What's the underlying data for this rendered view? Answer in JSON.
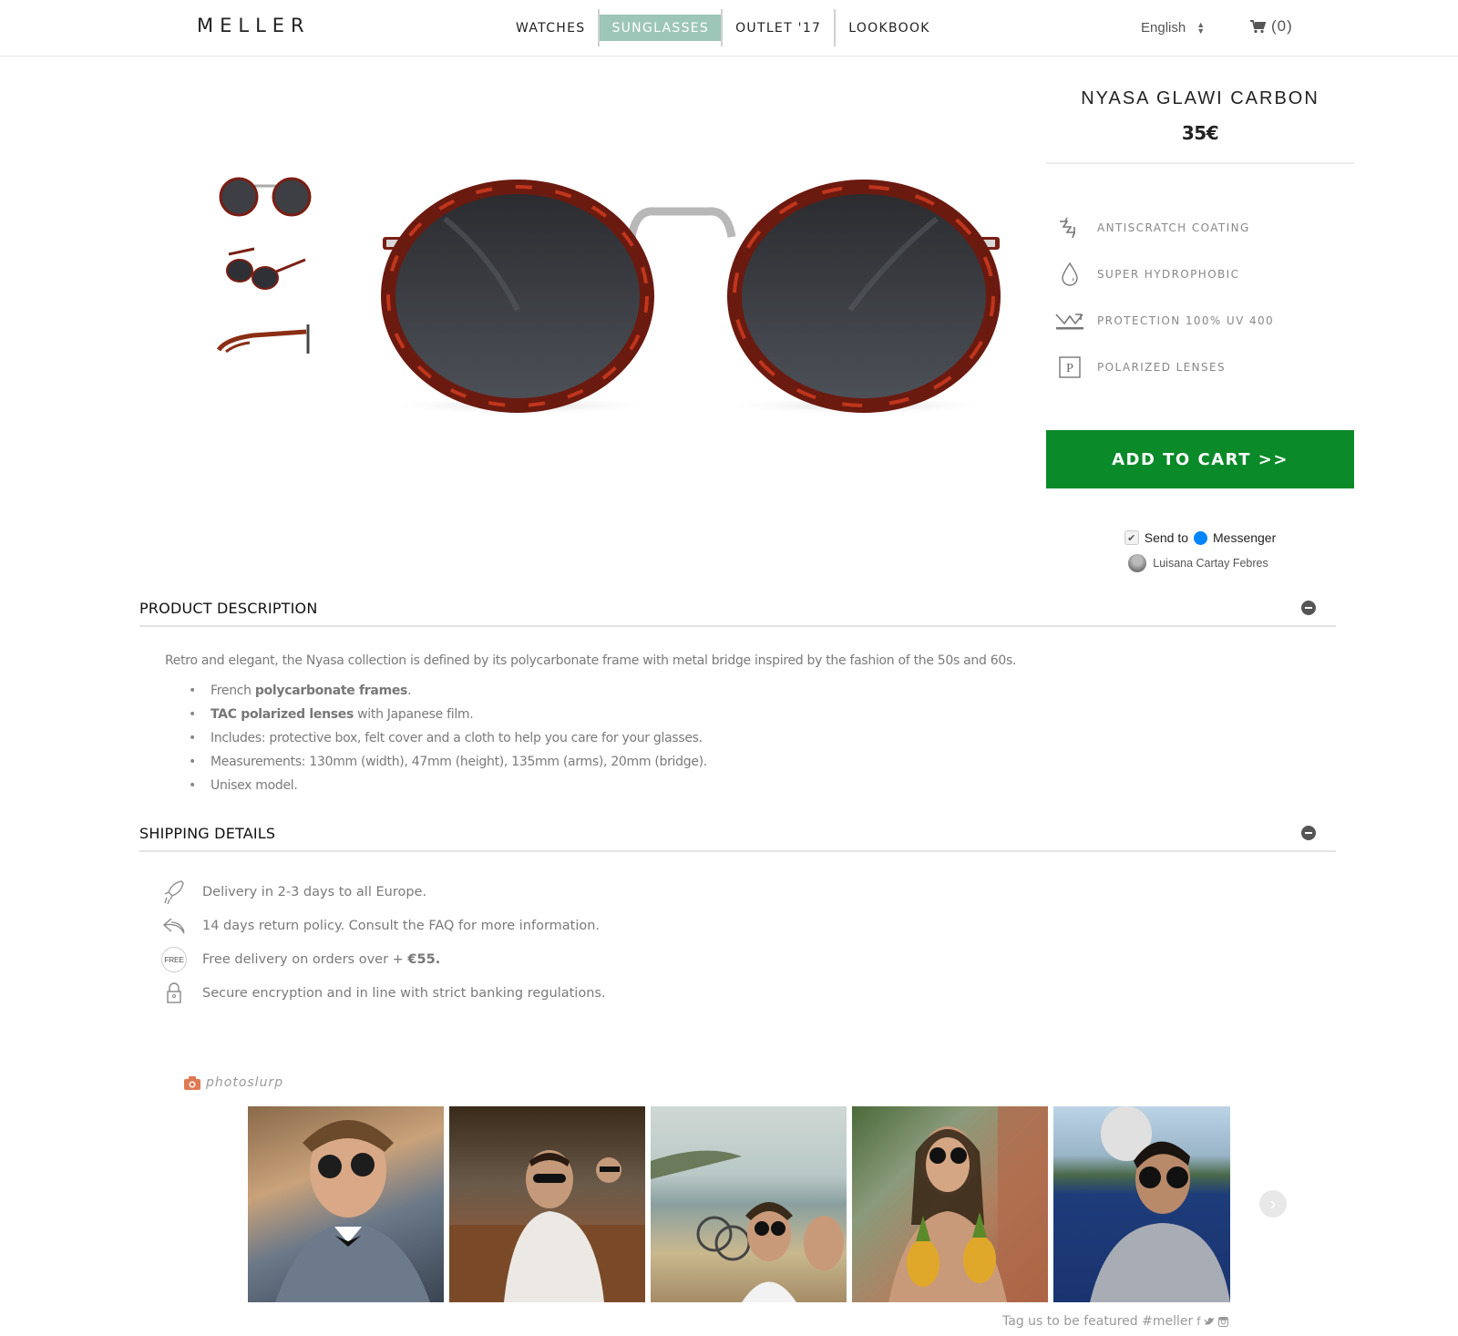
{
  "header": {
    "logo": "MELLER",
    "nav": [
      {
        "label": "WATCHES",
        "active": false
      },
      {
        "label": "SUNGLASSES",
        "active": true
      },
      {
        "label": "OUTLET '17",
        "active": false
      },
      {
        "label": "LOOKBOOK",
        "active": false
      }
    ],
    "language": "English",
    "cart_label": "(0)"
  },
  "product": {
    "title": "NYASA GLAWI CARBON",
    "price": "35€",
    "thumbnails": [
      "front-view",
      "angled-view",
      "side-view"
    ],
    "features": [
      {
        "icon": "antiscratch-icon",
        "label": "ANTISCRATCH COATING"
      },
      {
        "icon": "water-drop-icon",
        "label": "SUPER HYDROPHOBIC"
      },
      {
        "icon": "uv-protection-icon",
        "label": "PROTECTION 100% UV 400"
      },
      {
        "icon": "polarized-icon",
        "label": "POLARIZED LENSES"
      }
    ],
    "add_to_cart": "ADD TO CART >>",
    "messenger": {
      "send_to": "Send to",
      "messenger": "Messenger",
      "user": "Luisana Cartay Febres",
      "checked": true
    }
  },
  "description": {
    "title": "PRODUCT DESCRIPTION",
    "intro": "Retro and elegant, the Nyasa collection is defined by its polycarbonate frame with metal bridge inspired by the fashion of the 50s and 60s.",
    "bullets": [
      {
        "pre": "French ",
        "bold": "polycarbonate frames",
        "post": "."
      },
      {
        "pre": "",
        "bold": "TAC polarized lenses",
        "post": " with Japanese film."
      },
      {
        "pre": "Includes: protective box, felt cover and a cloth to help you care for your glasses.",
        "bold": "",
        "post": ""
      },
      {
        "pre": "Measurements: 130mm (width), 47mm (height), 135mm (arms), 20mm (bridge).",
        "bold": "",
        "post": ""
      },
      {
        "pre": "Unisex model.",
        "bold": "",
        "post": ""
      }
    ]
  },
  "shipping": {
    "title": "SHIPPING DETAILS",
    "items": [
      {
        "icon": "rocket-icon",
        "pre": "Delivery in 2-3 days to all Europe.",
        "bold": ""
      },
      {
        "icon": "return-icon",
        "pre": "14 days return policy. Consult the FAQ for more information.",
        "bold": ""
      },
      {
        "icon": "free-badge-icon",
        "badge": "FREE",
        "pre": "Free delivery on orders over + ",
        "bold": "€55."
      },
      {
        "icon": "lock-icon",
        "pre": "Secure encryption and in line with strict banking regulations.",
        "bold": ""
      }
    ]
  },
  "photoslurp": {
    "brand": "photoslurp",
    "photos": [
      "man-in-suit-sunglasses",
      "man-on-sofa-sunglasses",
      "couple-selfie-coast",
      "woman-with-pineapples",
      "man-by-sea-sunglasses"
    ],
    "tagline": "Tag us to be featured #meller",
    "social": [
      "facebook-icon",
      "twitter-icon",
      "instagram-icon"
    ]
  },
  "colors": {
    "nav_active": "#9dc6b8",
    "add_to_cart": "#0a8a28",
    "messenger": "#0084ff",
    "photoslurp": "#e07a53"
  }
}
